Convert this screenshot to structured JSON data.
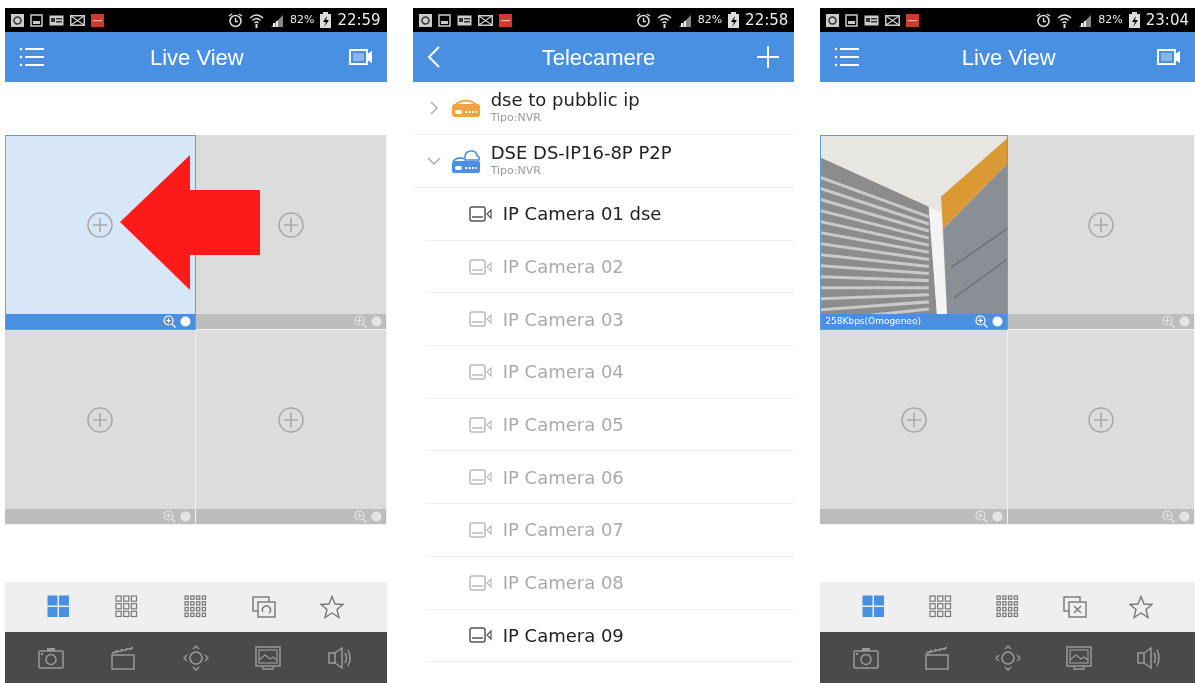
{
  "screens": [
    {
      "kind": "live_view",
      "status_bar": {
        "battery": "82%",
        "time": "22:59"
      },
      "app_bar": {
        "title": "Live View"
      },
      "tiles": [
        {
          "kind": "empty",
          "selected": true
        },
        {
          "kind": "empty",
          "selected": false
        },
        {
          "kind": "empty",
          "selected": false
        },
        {
          "kind": "empty",
          "selected": false
        }
      ],
      "annotation_arrow": true,
      "layout_bar": [
        {
          "kind": "split-4",
          "selected": true
        },
        {
          "kind": "split-9",
          "selected": false
        },
        {
          "kind": "split-16",
          "selected": false
        },
        {
          "kind": "sequence",
          "selected": false
        },
        {
          "kind": "favorite",
          "selected": false
        }
      ],
      "action_bar": [
        {
          "kind": "snapshot"
        },
        {
          "kind": "record"
        },
        {
          "kind": "ptz"
        },
        {
          "kind": "picture"
        },
        {
          "kind": "sound"
        }
      ]
    },
    {
      "kind": "device_list",
      "status_bar": {
        "battery": "82%",
        "time": "22:58"
      },
      "app_bar": {
        "title": "Telecamere"
      },
      "devices": [
        {
          "kind": "nvr",
          "name": "dse to pubblic ip",
          "type": "Tipo:NVR",
          "expanded": false
        },
        {
          "kind": "cloud-nvr",
          "name": "DSE DS-IP16-8P P2P",
          "type": "Tipo:NVR",
          "expanded": true,
          "children": [
            {
              "name": "IP Camera 01 dse",
              "online": true
            },
            {
              "name": "IP Camera 02",
              "online": false
            },
            {
              "name": "IP Camera 03",
              "online": false
            },
            {
              "name": "IP Camera 04",
              "online": false
            },
            {
              "name": "IP Camera 05",
              "online": false
            },
            {
              "name": "IP Camera 06",
              "online": false
            },
            {
              "name": "IP Camera 07",
              "online": false
            },
            {
              "name": "IP Camera 08",
              "online": false
            },
            {
              "name": "IP Camera 09",
              "online": true
            }
          ]
        }
      ]
    },
    {
      "kind": "live_view",
      "status_bar": {
        "battery": "82%",
        "time": "23:04"
      },
      "app_bar": {
        "title": "Live View"
      },
      "tiles": [
        {
          "kind": "video",
          "selected": true,
          "bitrate": "258Kbps(Omogeneo)"
        },
        {
          "kind": "empty",
          "selected": false
        },
        {
          "kind": "empty",
          "selected": false
        },
        {
          "kind": "empty",
          "selected": false
        }
      ],
      "layout_bar": [
        {
          "kind": "split-4",
          "selected": true
        },
        {
          "kind": "split-9",
          "selected": false
        },
        {
          "kind": "split-16",
          "selected": false
        },
        {
          "kind": "close-all",
          "selected": false
        },
        {
          "kind": "favorite",
          "selected": false
        }
      ],
      "action_bar": [
        {
          "kind": "snapshot"
        },
        {
          "kind": "record"
        },
        {
          "kind": "ptz"
        },
        {
          "kind": "picture"
        },
        {
          "kind": "sound"
        }
      ]
    }
  ]
}
